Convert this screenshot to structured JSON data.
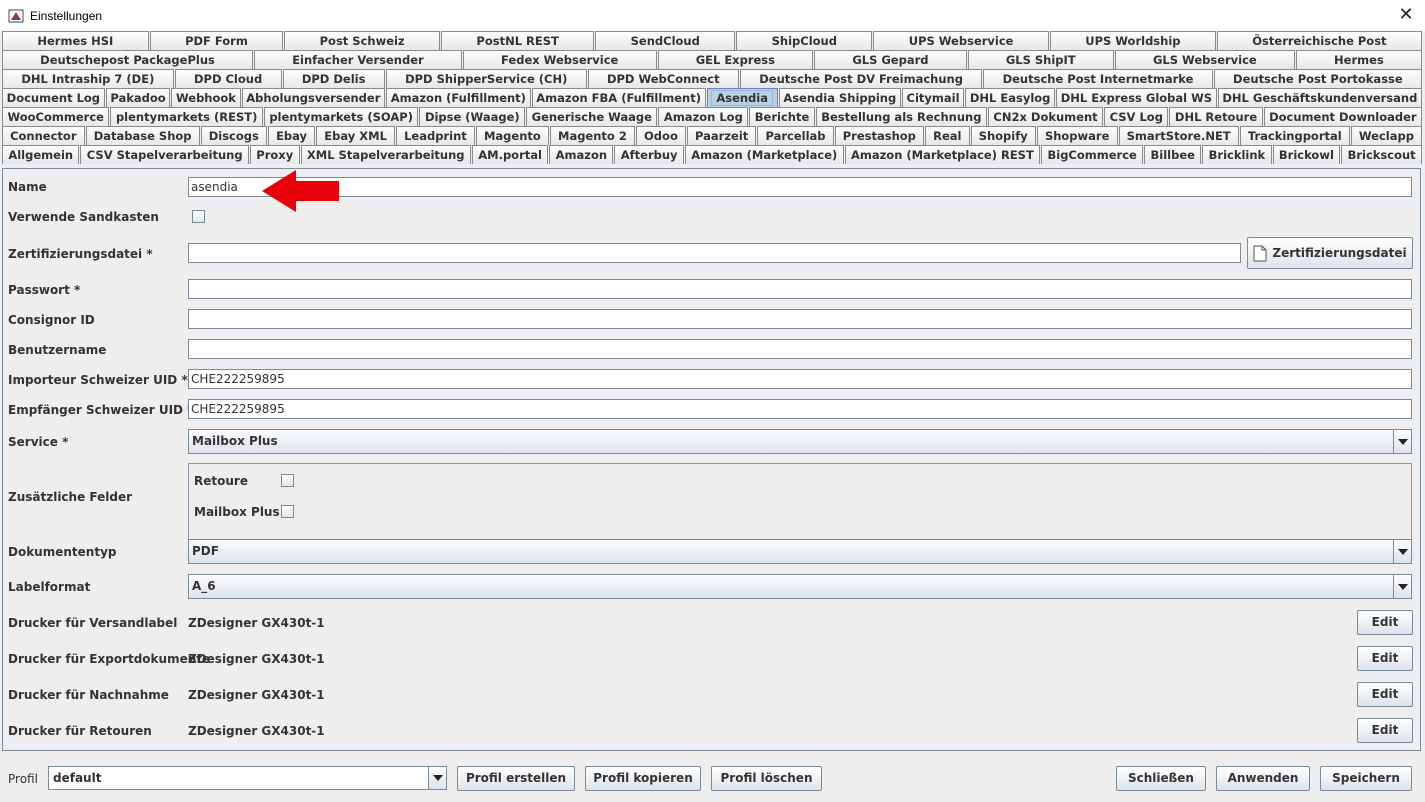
{
  "window": {
    "title": "Einstellungen",
    "close_glyph": "✕",
    "icon": "java-app-icon"
  },
  "tab_rows": [
    [
      "Hermes HSI",
      "PDF Form",
      "Post Schweiz",
      "PostNL REST",
      "SendCloud",
      "ShipCloud",
      "UPS Webservice",
      "UPS Worldship",
      "Österreichische Post"
    ],
    [
      "Deutschepost PackagePlus",
      "Einfacher Versender",
      "Fedex Webservice",
      "GEL Express",
      "GLS Gepard",
      "GLS ShipIT",
      "GLS Webservice",
      "Hermes"
    ],
    [
      "DHL Intraship 7 (DE)",
      "DPD Cloud",
      "DPD Delis",
      "DPD ShipperService (CH)",
      "DPD WebConnect",
      "Deutsche Post DV Freimachung",
      "Deutsche Post Internetmarke",
      "Deutsche Post Portokasse"
    ],
    [
      "Document Log",
      "Pakadoo",
      "Webhook",
      "Abholungsversender",
      "Amazon (Fulfillment)",
      "Amazon FBA (Fulfillment)",
      "Asendia",
      "Asendia Shipping",
      "Citymail",
      "DHL Easylog",
      "DHL Express Global WS",
      "DHL Geschäftskundenversand"
    ],
    [
      "WooCommerce",
      "plentymarkets (REST)",
      "plentymarkets (SOAP)",
      "Dipse (Waage)",
      "Generische Waage",
      "Amazon Log",
      "Berichte",
      "Bestellung als Rechnung",
      "CN2x Dokument",
      "CSV Log",
      "DHL Retoure",
      "Document Downloader"
    ],
    [
      "Connector",
      "Database Shop",
      "Discogs",
      "Ebay",
      "Ebay XML",
      "Leadprint",
      "Magento",
      "Magento 2",
      "Odoo",
      "Paarzeit",
      "Parcellab",
      "Prestashop",
      "Real",
      "Shopify",
      "Shopware",
      "SmartStore.NET",
      "Trackingportal",
      "Weclapp"
    ],
    [
      "Allgemein",
      "CSV Stapelverarbeitung",
      "Proxy",
      "XML Stapelverarbeitung",
      "AM.portal",
      "Amazon",
      "Afterbuy",
      "Amazon (Marketplace)",
      "Amazon (Marketplace) REST",
      "BigCommerce",
      "Billbee",
      "Bricklink",
      "Brickowl",
      "Brickscout"
    ]
  ],
  "selected_tab": "Asendia",
  "form": {
    "name_label": "Name",
    "name_value": "asendia",
    "sandbox_label": "Verwende Sandkasten",
    "cert_label": "Zertifizierungsdatei *",
    "cert_value": "",
    "cert_button": "Zertifizierungsdatei",
    "password_label": "Passwort *",
    "password_value": "",
    "consignor_label": "Consignor ID",
    "consignor_value": "",
    "username_label": "Benutzername",
    "username_value": "",
    "importer_label": "Importeur Schweizer UID *",
    "importer_value": "CHE222259895",
    "recipient_label": "Empfänger Schweizer UID *",
    "recipient_value": "CHE222259895",
    "service_label": "Service *",
    "service_value": "Mailbox Plus",
    "extra_label": "Zusätzliche Felder",
    "extra_retoure": "Retoure",
    "extra_mailbox": "Mailbox Plus",
    "doctype_label": "Dokumententyp",
    "doctype_value": "PDF",
    "labelformat_label": "Labelformat",
    "labelformat_value": "A_6",
    "printer_label_label": "Drucker für Versandlabel",
    "printer_label_value": "ZDesigner GX430t-1",
    "printer_export_label": "Drucker für Exportdokumente",
    "printer_export_value": "ZDesigner GX430t-1",
    "printer_cod_label": "Drucker für Nachnahme",
    "printer_cod_value": "ZDesigner GX430t-1",
    "printer_return_label": "Drucker für Retouren",
    "printer_return_value": "ZDesigner GX430t-1",
    "edit_button": "Edit"
  },
  "bottom": {
    "profile_label": "Profil",
    "profile_value": "default",
    "create": "Profil erstellen",
    "copy": "Profil kopieren",
    "delete": "Profil löschen",
    "close": "Schließen",
    "apply": "Anwenden",
    "save": "Speichern"
  },
  "colors": {
    "annotation_arrow": "#e8000b",
    "selected_tab": "#b8cfe5"
  }
}
